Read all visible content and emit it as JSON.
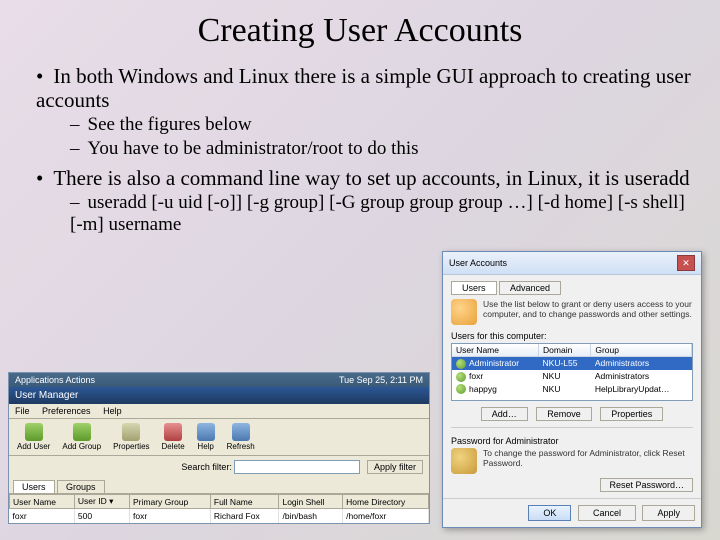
{
  "title": "Creating User Accounts",
  "bullets": {
    "b1": "In both Windows and Linux there is a simple GUI approach to creating user accounts",
    "b1a": "See the figures below",
    "b1b": "You have to be administrator/root to do this",
    "b2": "There is also a command line way to set up accounts, in Linux, it is useradd",
    "b2a": "useradd [-u uid [-o]] [-g group] [-G group group group …] [-d home] [-s shell] [-m] username"
  },
  "linux": {
    "panel_left": "Applications  Actions",
    "panel_right": "Tue Sep 25, 2:11 PM",
    "title": "User Manager",
    "menu": {
      "file": "File",
      "prefs": "Preferences",
      "help": "Help"
    },
    "tools": {
      "adduser": "Add User",
      "addgroup": "Add Group",
      "props": "Properties",
      "delete": "Delete",
      "help": "Help",
      "refresh": "Refresh"
    },
    "search_label": "Search filter:",
    "apply": "Apply filter",
    "tabs": {
      "users": "Users",
      "groups": "Groups"
    },
    "cols": {
      "uname": "User Name",
      "uid": "User ID ▾",
      "pgrp": "Primary Group",
      "fname": "Full Name",
      "shell": "Login Shell",
      "home": "Home Directory"
    },
    "row": {
      "uname": "foxr",
      "uid": "500",
      "pgrp": "foxr",
      "fname": "Richard Fox",
      "shell": "/bin/bash",
      "home": "/home/foxr"
    }
  },
  "win": {
    "title": "User Accounts",
    "tabs": {
      "users": "Users",
      "adv": "Advanced"
    },
    "hint": "Use the list below to grant or deny users access to your computer, and to change passwords and other settings.",
    "sect": "Users for this computer:",
    "cols": {
      "uname": "User Name",
      "dom": "Domain",
      "grp": "Group"
    },
    "rows": [
      {
        "uname": "Administrator",
        "dom": "NKU-L55",
        "grp": "Administrators"
      },
      {
        "uname": "foxr",
        "dom": "NKU",
        "grp": "Administrators"
      },
      {
        "uname": "happyg",
        "dom": "NKU",
        "grp": "HelpLibraryUpdat…"
      }
    ],
    "btn": {
      "add": "Add…",
      "remove": "Remove",
      "props": "Properties"
    },
    "pwd_sect": "Password for Administrator",
    "pwd_hint": "To change the password for Administrator, click Reset Password.",
    "reset": "Reset Password…",
    "ok": "OK",
    "cancel": "Cancel",
    "apply": "Apply"
  }
}
